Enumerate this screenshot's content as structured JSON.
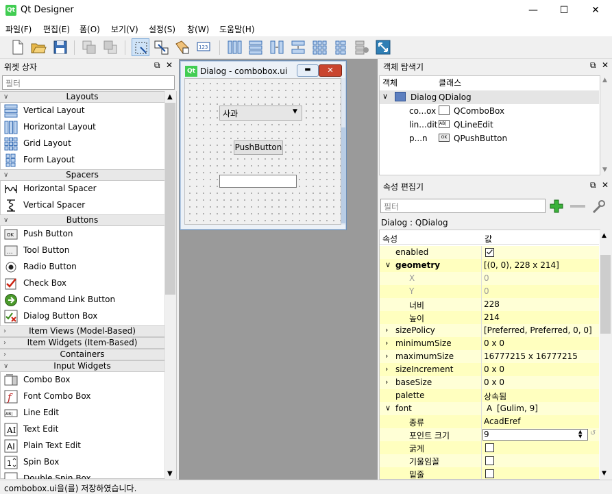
{
  "window": {
    "title": "Qt Designer",
    "app_icon_text": "Qt"
  },
  "menu": [
    "파일(F)",
    "편집(E)",
    "폼(O)",
    "보기(V)",
    "설정(S)",
    "창(W)",
    "도움말(H)"
  ],
  "widget_box": {
    "title": "위젯 상자",
    "filter_placeholder": "필터",
    "categories": {
      "layouts": "Layouts",
      "spacers": "Spacers",
      "buttons": "Buttons",
      "item_views": "Item Views (Model-Based)",
      "item_widgets": "Item Widgets (Item-Based)",
      "containers": "Containers",
      "input_widgets": "Input Widgets"
    },
    "layouts": [
      "Vertical Layout",
      "Horizontal Layout",
      "Grid Layout",
      "Form Layout"
    ],
    "spacers": [
      "Horizontal Spacer",
      "Vertical Spacer"
    ],
    "buttons": [
      "Push Button",
      "Tool Button",
      "Radio Button",
      "Check Box",
      "Command Link Button",
      "Dialog Button Box"
    ],
    "input_widgets": [
      "Combo Box",
      "Font Combo Box",
      "Line Edit",
      "Text Edit",
      "Plain Text Edit",
      "Spin Box",
      "Double Spin Box"
    ]
  },
  "form": {
    "title": "Dialog - combobox.ui",
    "combo_value": "사과",
    "push_button": "PushButton",
    "line_edit_value": ""
  },
  "object_inspector": {
    "title": "객체 탐색기",
    "col_object": "객체",
    "col_class": "클래스",
    "rows": [
      {
        "object": "Dialog",
        "class": "QDialog"
      },
      {
        "object": "co...ox",
        "class": "QComboBox"
      },
      {
        "object": "lin...dit",
        "class": "QLineEdit"
      },
      {
        "object": "p...n",
        "class": "QPushButton"
      }
    ]
  },
  "property_editor": {
    "title": "속성 편집기",
    "filter_placeholder": "필터",
    "context": "Dialog : QDialog",
    "col_property": "속성",
    "col_value": "값",
    "rows": [
      {
        "name": "enabled",
        "value": ""
      },
      {
        "name": "geometry",
        "value": "[(0, 0), 228 x 214]"
      },
      {
        "name": "X",
        "value": "0"
      },
      {
        "name": "Y",
        "value": "0"
      },
      {
        "name": "너비",
        "value": "228"
      },
      {
        "name": "높이",
        "value": "214"
      },
      {
        "name": "sizePolicy",
        "value": "[Preferred, Preferred, 0, 0]"
      },
      {
        "name": "minimumSize",
        "value": "0 x 0"
      },
      {
        "name": "maximumSize",
        "value": "16777215 x 16777215"
      },
      {
        "name": "sizeIncrement",
        "value": "0 x 0"
      },
      {
        "name": "baseSize",
        "value": "0 x 0"
      },
      {
        "name": "palette",
        "value": "상속됨"
      },
      {
        "name": "font",
        "value": "[Gulim, 9]"
      },
      {
        "name": "종류",
        "value": "AcadEref"
      },
      {
        "name": "포인트 크기",
        "value": "9"
      },
      {
        "name": "굵게",
        "value": ""
      },
      {
        "name": "기울임꼴",
        "value": ""
      },
      {
        "name": "밑줄",
        "value": ""
      }
    ]
  },
  "status": "combobox.ui을(를) 저장하였습니다."
}
